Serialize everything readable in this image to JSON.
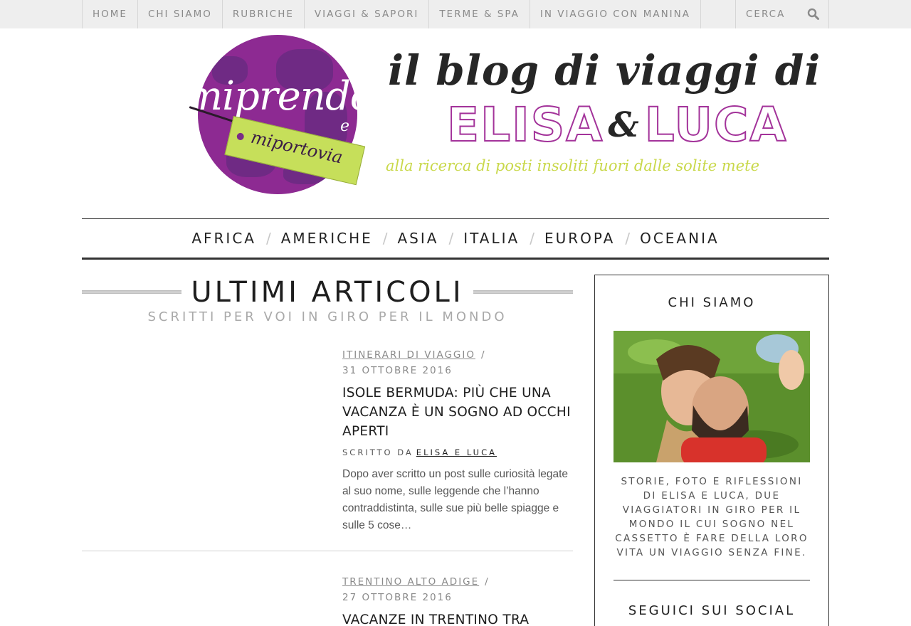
{
  "topnav": {
    "items": [
      "HOME",
      "CHI SIAMO",
      "RUBRICHE",
      "VIAGGI & SAPORI",
      "TERME & SPA",
      "IN VIAGGIO CON MANINA"
    ],
    "search_placeholder": "CERCA",
    "search_icon": "search-icon"
  },
  "logo": {
    "word1": "miprendo",
    "e": "e",
    "word2": "miportovia",
    "colors": {
      "globe": "#8d2a92",
      "tag": "#c6df5a"
    }
  },
  "header": {
    "title": "il blog di viaggi di",
    "name1": "ELISA",
    "amp": "&",
    "name2": "LUCA",
    "tagline": "alla ricerca di posti insoliti fuori dalle solite mete"
  },
  "categories": [
    "AFRICA",
    "AMERICHE",
    "ASIA",
    "ITALIA",
    "EUROPA",
    "OCEANIA"
  ],
  "category_separator": "/",
  "section": {
    "title": "ULTIMI ARTICOLI",
    "subtitle": "SCRITTI PER VOI IN GIRO PER IL MONDO"
  },
  "posts": [
    {
      "category": "ITINERARI DI VIAGGIO",
      "date": "31 OTTOBRE 2016",
      "title": "ISOLE BERMUDA: PIÙ CHE UNA VACANZA È UN SOGNO AD OCCHI APERTI",
      "byline": "SCRITTO DA",
      "author": "ELISA E LUCA",
      "excerpt": "Dopo aver scritto un post sulle curiosità legate al suo nome, sulle leggende che l’hanno contraddistinta, sulle sue più belle spiagge e sulle 5 cose…"
    },
    {
      "category": "TRENTINO ALTO ADIGE",
      "date": "27 OTTOBRE 2016",
      "title": "VACANZE IN TRENTINO TRA"
    }
  ],
  "post_separator": "/",
  "sidebar": {
    "about_title": "CHI SIAMO",
    "about_text": "STORIE, FOTO E RIFLESSIONI DI ELISA E LUCA, DUE VIAGGIATORI IN GIRO PER IL MONDO IL CUI SOGNO NEL CASSETTO È FARE DELLA LORO VITA UN VIAGGIO SENZA FINE.",
    "social_title": "SEGUICI SUI SOCIAL"
  }
}
